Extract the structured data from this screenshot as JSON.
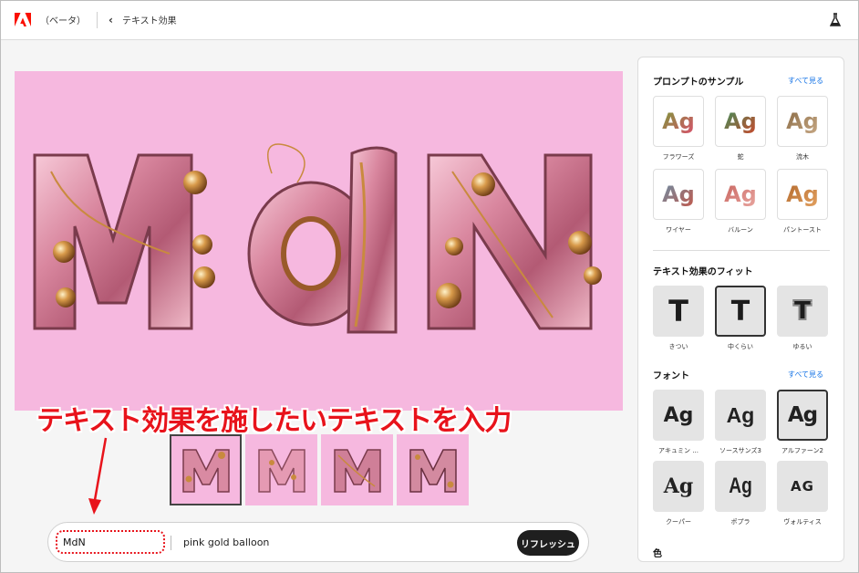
{
  "header": {
    "beta_label": "（ベータ）",
    "back_glyph": "‹",
    "title": "テキスト効果"
  },
  "colors": {
    "canvas_bg": "#f6b8df",
    "accent_link": "#1473e6",
    "annotation_red": "#e8131b",
    "refresh_bg": "#1f1f1f"
  },
  "canvas": {
    "letters": [
      "M",
      "d",
      "N"
    ]
  },
  "annotation": {
    "caption": "テキスト効果を施したいテキストを入力"
  },
  "variations": {
    "letters": [
      "M",
      "M",
      "M",
      "M"
    ],
    "selected_index": 0
  },
  "prompt": {
    "text_value": "MdN",
    "prompt_value": "pink gold balloon",
    "refresh_label": "リフレッシュ"
  },
  "panel": {
    "samples": {
      "title": "プロンプトのサンプル",
      "see_all": "すべて見る",
      "items": [
        {
          "label": "フラワーズ",
          "glyph": "Ag",
          "c1": "#7b9a3a",
          "c2": "#d94f6b"
        },
        {
          "label": "蛇",
          "glyph": "Ag",
          "c1": "#3f8f5a",
          "c2": "#c9482c"
        },
        {
          "label": "流木",
          "glyph": "Ag",
          "c1": "#8a6a45",
          "c2": "#c7a985"
        },
        {
          "label": "ワイヤー",
          "glyph": "Ag",
          "c1": "#6b8fa6",
          "c2": "#c2584b"
        },
        {
          "label": "バルーン",
          "glyph": "Ag",
          "c1": "#c8645f",
          "c2": "#e9a6a0"
        },
        {
          "label": "パントースト",
          "glyph": "Ag",
          "c1": "#b36a2e",
          "c2": "#e3a160"
        }
      ]
    },
    "fit": {
      "title": "テキスト効果のフィット",
      "items": [
        {
          "label": "きつい",
          "glyph": "T"
        },
        {
          "label": "中くらい",
          "glyph": "T"
        },
        {
          "label": "ゆるい",
          "glyph": "T"
        }
      ],
      "selected_index": 1
    },
    "fonts": {
      "title": "フォント",
      "see_all": "すべて見る",
      "items": [
        {
          "label": "アキュミン ...",
          "glyph": "Ag"
        },
        {
          "label": "ソースサンズ3",
          "glyph": "Ag"
        },
        {
          "label": "アルファーン2",
          "glyph": "Ag"
        },
        {
          "label": "クーパー",
          "glyph": "Ag"
        },
        {
          "label": "ポプラ",
          "glyph": "Ag"
        },
        {
          "label": "ヴォルティス",
          "glyph": "AG"
        }
      ],
      "selected_index": 2
    },
    "color_title": "色"
  }
}
